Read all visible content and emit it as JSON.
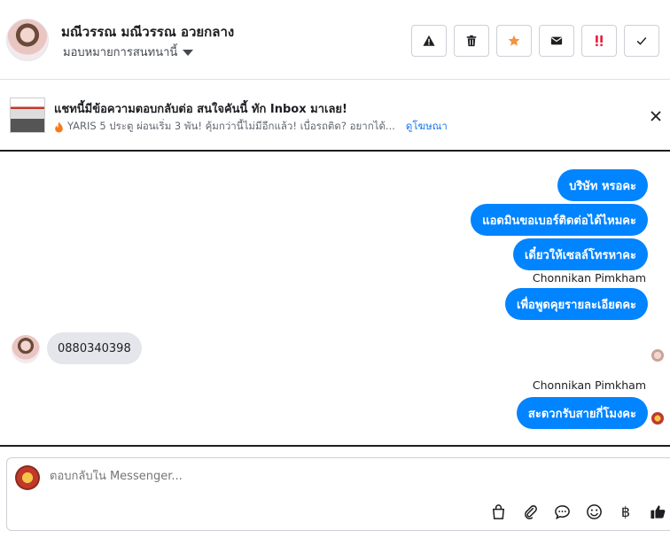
{
  "header": {
    "contact_name": "มณีวรรณ มณีวรรณ อวยกลาง",
    "assign_label": "มอบหมายการสนทนานี้",
    "actions": [
      {
        "name": "report-spam-button",
        "icon": "warning-icon"
      },
      {
        "name": "delete-button",
        "icon": "trash-icon"
      },
      {
        "name": "star-button",
        "icon": "star-icon"
      },
      {
        "name": "mark-unread-button",
        "icon": "envelope-icon"
      },
      {
        "name": "follow-up-button",
        "icon": "double-exclamation-icon"
      },
      {
        "name": "mark-done-button",
        "icon": "checkmark-icon"
      }
    ]
  },
  "ad": {
    "title": "แชทนี้มีข้อความตอบกลับต่อ สนใจคันนี้ ทัก Inbox มาเลย!",
    "description": "YARIS 5 ประตู ผ่อนเริ่ม 3 พัน! คุ้มกว่านี้ไม่มีอีกแล้ว! เบื่อรถติด? อยากได้...",
    "link": "ดูโฆษณา"
  },
  "messages": {
    "out1": "บริษัท หรอคะ",
    "out2": "แอดมินขอเบอร์ติดต่อได้ไหมคะ",
    "out3": "เดี๋ยวให้เซลล์โทรหาคะ",
    "sender1": "Chonnikan Pimkham",
    "out4": "เพื่อพูดคุยรายละเอียดคะ",
    "in1": "0880340398",
    "sender2": "Chonnikan Pimkham",
    "out5": "สะดวกรับสายกี่โมงคะ"
  },
  "composer": {
    "placeholder": "ตอบกลับใน Messenger...",
    "tools": [
      "saved-replies-icon",
      "attachment-icon",
      "quick-replies-icon",
      "emoji-icon",
      "payment-icon",
      "like-icon"
    ],
    "currency_symbol": "฿"
  },
  "colors": {
    "accent": "#0084ff",
    "incoming_bubble": "#e4e6eb",
    "star": "#f5923e",
    "follow_up": "#e41e3f"
  }
}
